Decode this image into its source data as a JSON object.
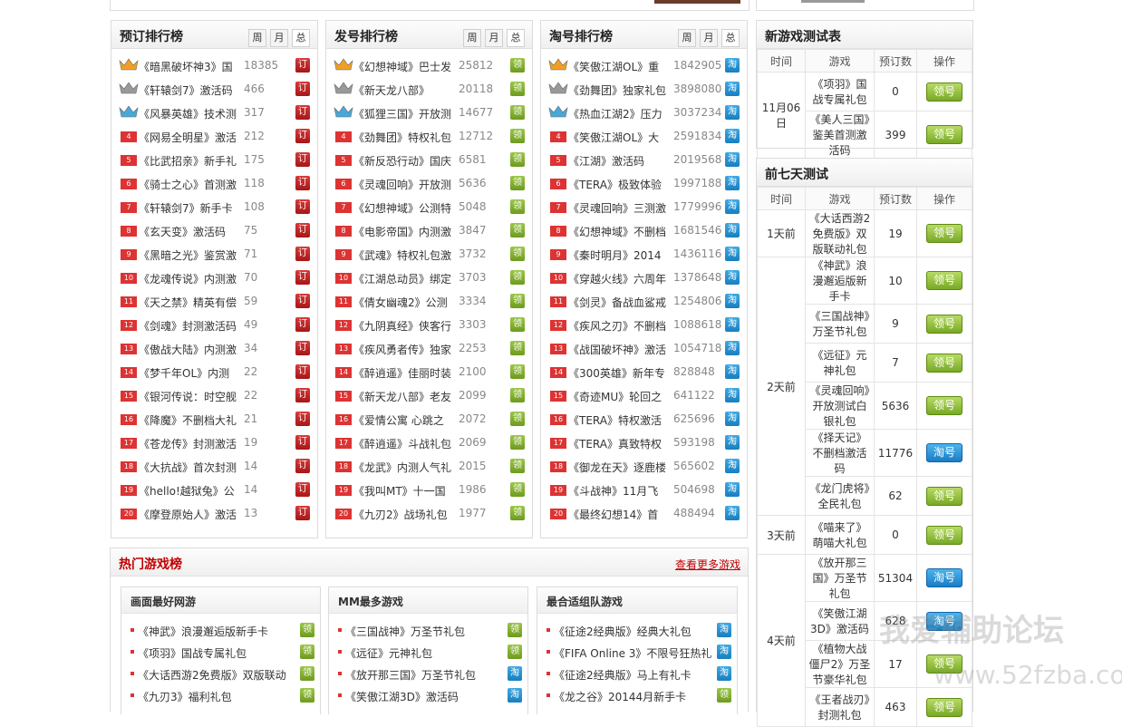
{
  "rank_panels": [
    {
      "title": "预订排行榜",
      "tabs": [
        "周",
        "月",
        "总"
      ],
      "btn": "订",
      "items": [
        {
          "name": "《暗黑破坏神3》国",
          "count": "18385"
        },
        {
          "name": "《轩辕剑7》激活码",
          "count": "466"
        },
        {
          "name": "《风暴英雄》技术测",
          "count": "317"
        },
        {
          "name": "《网易全明星》激活",
          "count": "212"
        },
        {
          "name": "《比武招亲》新手礼",
          "count": "175"
        },
        {
          "name": "《骑士之心》首测激",
          "count": "118"
        },
        {
          "name": "《轩辕剑7》新手卡",
          "count": "108"
        },
        {
          "name": "《玄天变》激活码",
          "count": "75"
        },
        {
          "name": "《黑暗之光》鉴赏激",
          "count": "71"
        },
        {
          "name": "《龙魂传说》内测激",
          "count": "70"
        },
        {
          "name": "《天之禁》精英有偿",
          "count": "59"
        },
        {
          "name": "《剑魂》封测激活码",
          "count": "49"
        },
        {
          "name": "《傲战大陆》内测激",
          "count": "34"
        },
        {
          "name": "《梦千年OL》内测",
          "count": "22"
        },
        {
          "name": "《银河传说：时空舰",
          "count": "22"
        },
        {
          "name": "《降魔》不删档大礼",
          "count": "21"
        },
        {
          "name": "《苍龙传》封测激活",
          "count": "19"
        },
        {
          "name": "《大抗战》首次封测",
          "count": "14"
        },
        {
          "name": "《hello!越狱兔》公",
          "count": "14"
        },
        {
          "name": "《摩登原始人》激活",
          "count": "13"
        }
      ]
    },
    {
      "title": "发号排行榜",
      "tabs": [
        "周",
        "月",
        "总"
      ],
      "btn": "领",
      "items": [
        {
          "name": "《幻想神域》巴士发",
          "count": "25812"
        },
        {
          "name": "《新天龙八部》",
          "count": "20118"
        },
        {
          "name": "《狐狸三国》开放测",
          "count": "14677"
        },
        {
          "name": "《劲舞团》特权礼包",
          "count": "12712"
        },
        {
          "name": "《新反恐行动》国庆",
          "count": "6581"
        },
        {
          "name": "《灵魂回响》开放测",
          "count": "5636"
        },
        {
          "name": "《幻想神域》公测特",
          "count": "5048"
        },
        {
          "name": "《电影帝国》内测激",
          "count": "3847"
        },
        {
          "name": "《武魂》特权礼包激",
          "count": "3732"
        },
        {
          "name": "《江湖总动员》绑定",
          "count": "3703"
        },
        {
          "name": "《倩女幽魂2》公测",
          "count": "3334"
        },
        {
          "name": "《九阴真经》侠客行",
          "count": "3303"
        },
        {
          "name": "《疾风勇者传》独家",
          "count": "2253"
        },
        {
          "name": "《醉逍遥》佳丽时装",
          "count": "2100"
        },
        {
          "name": "《新天龙八部》老友",
          "count": "2099"
        },
        {
          "name": "《爱情公寓 心跳之",
          "count": "2072"
        },
        {
          "name": "《醉逍遥》斗战礼包",
          "count": "2069"
        },
        {
          "name": "《龙武》内测人气礼",
          "count": "2015"
        },
        {
          "name": "《我叫MT》十一国",
          "count": "1986"
        },
        {
          "name": "《九刃2》战场礼包",
          "count": "1977"
        }
      ]
    },
    {
      "title": "淘号排行榜",
      "tabs": [
        "周",
        "月",
        "总"
      ],
      "btn": "淘",
      "items": [
        {
          "name": "《笑傲江湖OL》重",
          "count": "1842905"
        },
        {
          "name": "《劲舞团》独家礼包",
          "count": "3898080"
        },
        {
          "name": "《热血江湖2》压力",
          "count": "3037234"
        },
        {
          "name": "《笑傲江湖OL》大",
          "count": "2591834"
        },
        {
          "name": "《江湖》激活码",
          "count": "2019568"
        },
        {
          "name": "《TERA》极致体验",
          "count": "1997188"
        },
        {
          "name": "《灵魂回响》三测激",
          "count": "1779996"
        },
        {
          "name": "《幻想神域》不删档",
          "count": "1681546"
        },
        {
          "name": "《秦时明月》2014",
          "count": "1436116"
        },
        {
          "name": "《穿越火线》六周年",
          "count": "1378648"
        },
        {
          "name": "《剑灵》备战血鲨戒",
          "count": "1254806"
        },
        {
          "name": "《疾风之刃》不删档",
          "count": "1088618"
        },
        {
          "name": "《战国破坏神》激活",
          "count": "1054718"
        },
        {
          "name": "《300英雄》新年专",
          "count": "828848"
        },
        {
          "name": "《奇迹MU》轮回之",
          "count": "641122"
        },
        {
          "name": "《TERA》特权激活",
          "count": "625696"
        },
        {
          "name": "《TERA》真致特权",
          "count": "593198"
        },
        {
          "name": "《御龙在天》逐鹿楼",
          "count": "565602"
        },
        {
          "name": "《斗战神》11月飞",
          "count": "504698"
        },
        {
          "name": "《最终幻想14》首",
          "count": "488494"
        }
      ]
    }
  ],
  "hot": {
    "title": "热门游戏榜",
    "more": "查看更多游戏",
    "subs": [
      {
        "title": "画面最好网游",
        "items": [
          {
            "name": "《神武》浪漫邂逅版新手卡",
            "btn": "领"
          },
          {
            "name": "《项羽》国战专属礼包",
            "btn": "领"
          },
          {
            "name": "《大话西游2免费版》双版联动",
            "btn": "领"
          },
          {
            "name": "《九刃3》福利礼包",
            "btn": "领"
          }
        ]
      },
      {
        "title": "MM最多游戏",
        "items": [
          {
            "name": "《三国战神》万圣节礼包",
            "btn": "领"
          },
          {
            "name": "《远征》元神礼包",
            "btn": "领"
          },
          {
            "name": "《放开那三国》万圣节礼包",
            "btn": "淘"
          },
          {
            "name": "《笑傲江湖3D》激活码",
            "btn": "淘"
          }
        ]
      },
      {
        "title": "最合适组队游戏",
        "items": [
          {
            "name": "《征途2经典版》经典大礼包",
            "btn": "淘"
          },
          {
            "name": "《FIFA Online 3》不限号狂热礼",
            "btn": "淘"
          },
          {
            "name": "《征途2经典版》马上有礼卡",
            "btn": "淘"
          },
          {
            "name": "《龙之谷》20144月新手卡",
            "btn": "领"
          }
        ]
      }
    ]
  },
  "test_table": {
    "title": "新游戏测试表",
    "headers": [
      "时间",
      "游戏",
      "预订数",
      "操作"
    ],
    "date": "11月06日",
    "rows": [
      {
        "game": "《项羽》国战专属礼包",
        "count": "0",
        "action": "领号"
      },
      {
        "game": "《美人三国》鉴美首测激活码",
        "count": "399",
        "action": "领号"
      }
    ]
  },
  "week_table": {
    "title": "前七天测试",
    "headers": [
      "时间",
      "游戏",
      "预订数",
      "操作"
    ],
    "groups": [
      {
        "time": "1天前",
        "rows": [
          {
            "game": "《大话西游2免费版》双版联动礼包",
            "count": "19",
            "action": "领号"
          }
        ]
      },
      {
        "time": "2天前",
        "rows": [
          {
            "game": "《神武》浪漫邂逅版新手卡",
            "count": "10",
            "action": "领号"
          },
          {
            "game": "《三国战神》万圣节礼包",
            "count": "9",
            "action": "领号"
          },
          {
            "game": "《远征》元神礼包",
            "count": "7",
            "action": "领号"
          },
          {
            "game": "《灵魂回响》开放测试白银礼包",
            "count": "5636",
            "action": "领号"
          },
          {
            "game": "《择天记》不删档激活码",
            "count": "11776",
            "action": "淘号"
          },
          {
            "game": "《龙门虎将》全民礼包",
            "count": "62",
            "action": "领号"
          }
        ]
      },
      {
        "time": "3天前",
        "rows": [
          {
            "game": "《喵来了》萌喵大礼包",
            "count": "0",
            "action": "领号"
          }
        ]
      },
      {
        "time": "4天前",
        "rows": [
          {
            "game": "《放开那三国》万圣节礼包",
            "count": "51304",
            "action": "淘号"
          },
          {
            "game": "《笑傲江湖3D》激活码",
            "count": "628",
            "action": "淘号"
          },
          {
            "game": "《植物大战僵尸2》万圣节豪华礼包",
            "count": "17",
            "action": "领号"
          },
          {
            "game": "《王者战刃》封测礼包",
            "count": "463",
            "action": "领号"
          }
        ]
      }
    ]
  },
  "watermark": {
    "line1": "我爱辅助论坛",
    "line2": "www.52fzba.com"
  },
  "colors": {
    "red_btn": "#c0201f",
    "green_btn": "#7aab24",
    "blue_btn": "#1a7dc6",
    "title_red": "#c00000"
  }
}
